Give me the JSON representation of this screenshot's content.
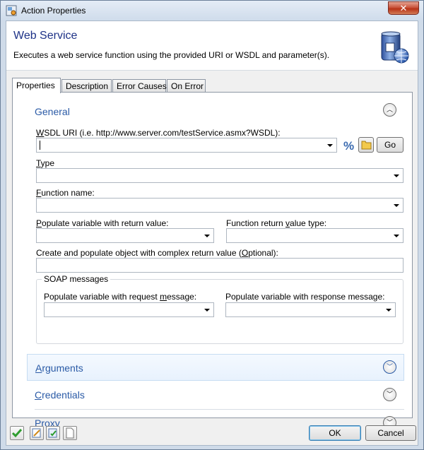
{
  "window": {
    "title": "Action Properties",
    "close_label": "✕"
  },
  "header": {
    "title": "Web Service",
    "description": "Executes a web service function using the provided URI or WSDL and parameter(s)."
  },
  "tabs": [
    {
      "label": "Properties",
      "active": true
    },
    {
      "label": "Description",
      "active": false
    },
    {
      "label": "Error Causes",
      "active": false
    },
    {
      "label": "On Error",
      "active": false
    }
  ],
  "general": {
    "title": "General",
    "wsdl": {
      "label_u": "W",
      "label_rest": "SDL URI (i.e. http://www.server.com/testService.asmx?WSDL):",
      "value": ""
    },
    "go_label": "Go",
    "type": {
      "label_u": "T",
      "label_rest": "ype",
      "value": ""
    },
    "function_name": {
      "label_u": "F",
      "label_rest": "unction name:",
      "value": ""
    },
    "populate_return": {
      "label_u": "P",
      "label_rest": "opulate variable with return value:",
      "value": ""
    },
    "return_type": {
      "label_pre": "Function return ",
      "label_u": "v",
      "label_rest": "alue type:",
      "value": ""
    },
    "complex_return": {
      "label_pre": "Create and populate object with complex return value (",
      "label_u": "O",
      "label_rest": "ptional):",
      "value": ""
    },
    "soap": {
      "label": "SOAP messages",
      "request": {
        "label_pre": "Populate variable with request ",
        "label_u": "m",
        "label_rest": "essage:",
        "value": ""
      },
      "response": {
        "label": "Populate variable with response message:",
        "value": ""
      }
    }
  },
  "sections": {
    "arguments": {
      "label_u": "A",
      "label_rest": "rguments"
    },
    "credentials": {
      "label_u": "C",
      "label_rest": "redentials"
    },
    "proxy": {
      "label_pre": "Pro",
      "label_u": "x",
      "label_rest": "y"
    }
  },
  "footer": {
    "ok_label": "OK",
    "cancel_label": "Cancel"
  },
  "colors": {
    "section_title": "#2a5aa6",
    "header_title": "#1e3287",
    "close_button": "#c9533b"
  }
}
